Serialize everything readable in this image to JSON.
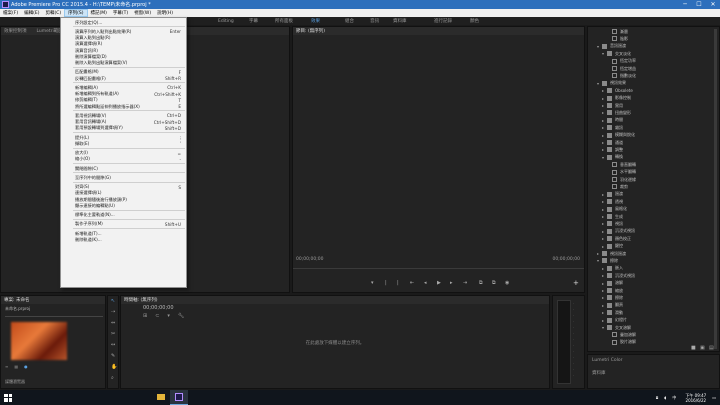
{
  "window": {
    "title": "Adobe Premiere Pro CC 2015.4 - H:\\TEMP\\未命名.prproj *",
    "minimize": "─",
    "maximize": "☐",
    "close": "✕"
  },
  "menubar": [
    {
      "label": "檔案(F)"
    },
    {
      "label": "編輯(E)"
    },
    {
      "label": "剪輯(C)"
    },
    {
      "label": "序列(S)"
    },
    {
      "label": "標記(M)"
    },
    {
      "label": "字幕(T)"
    },
    {
      "label": "視窗(W)"
    },
    {
      "label": "說明(H)"
    }
  ],
  "workspaces": [
    "Editing",
    "字幕",
    "所有面板",
    "效果",
    "組合",
    "音訊",
    "資料庫",
    "進行記錄",
    "顏色"
  ],
  "dropdown": {
    "items": [
      {
        "label": "序列設定(Q)...",
        "shortcut": "",
        "disabled": false
      },
      {
        "label": "",
        "sep": true
      },
      {
        "label": "演算序列的入點到出點效果(R)",
        "shortcut": "Enter",
        "disabled": false
      },
      {
        "label": "演算入點到出點(R)",
        "shortcut": "",
        "disabled": false
      },
      {
        "label": "演算選擇項(R)",
        "shortcut": "",
        "disabled": false
      },
      {
        "label": "演算音訊(R)",
        "shortcut": "",
        "disabled": false
      },
      {
        "label": "刪除演算檔案(D)",
        "shortcut": "",
        "disabled": false
      },
      {
        "label": "刪除入點到出點演算檔案(V)",
        "shortcut": "",
        "disabled": false
      },
      {
        "label": "",
        "sep": true
      },
      {
        "label": "匹配畫格(M)",
        "shortcut": "F",
        "disabled": false
      },
      {
        "label": "反轉匹配畫格(F)",
        "shortcut": "Shift+R",
        "disabled": false
      },
      {
        "label": "",
        "sep": true
      },
      {
        "label": "新增編輯(A)",
        "shortcut": "Ctrl+K",
        "disabled": false
      },
      {
        "label": "新增編輯到所有軌道(A)",
        "shortcut": "Ctrl+Shift+K",
        "disabled": false
      },
      {
        "label": "修剪編輯(T)",
        "shortcut": "T",
        "disabled": false
      },
      {
        "label": "將所選編輯點延伸到播放指示器(X)",
        "shortcut": "E",
        "disabled": false
      },
      {
        "label": "",
        "sep": true
      },
      {
        "label": "套用視訊轉場(V)",
        "shortcut": "Ctrl+D",
        "disabled": false
      },
      {
        "label": "套用音訊轉場(A)",
        "shortcut": "Ctrl+Shift+D",
        "disabled": false
      },
      {
        "label": "套用預設轉場到選擇項(Y)",
        "shortcut": "Shift+D",
        "disabled": false
      },
      {
        "label": "",
        "sep": true
      },
      {
        "label": "提升(L)",
        "shortcut": ";",
        "disabled": false
      },
      {
        "label": "擷取(E)",
        "shortcut": "'",
        "disabled": false
      },
      {
        "label": "",
        "sep": true
      },
      {
        "label": "放大(I)",
        "shortcut": "=",
        "disabled": false
      },
      {
        "label": "縮小(O)",
        "shortcut": "-",
        "disabled": false
      },
      {
        "label": "",
        "sep": true
      },
      {
        "label": "關閉間隙(C)",
        "shortcut": "",
        "disabled": false
      },
      {
        "label": "",
        "sep": true
      },
      {
        "label": "至序列中的間隙(G)",
        "shortcut": "",
        "disabled": false
      },
      {
        "label": "",
        "sep": true
      },
      {
        "label": "對齊(S)",
        "shortcut": "S",
        "disabled": false
      },
      {
        "label": "連接選擇項(L)",
        "shortcut": "",
        "disabled": false
      },
      {
        "label": "播放期間隨後進行播放頭(P)",
        "shortcut": "",
        "disabled": false
      },
      {
        "label": "顯示連接的編輯點(U)",
        "shortcut": "",
        "disabled": false
      },
      {
        "label": "",
        "sep": true
      },
      {
        "label": "標準化主要軌道(N)...",
        "shortcut": "",
        "disabled": false
      },
      {
        "label": "",
        "sep": true
      },
      {
        "label": "製作子序列(M)",
        "shortcut": "Shift+U",
        "disabled": false
      },
      {
        "label": "",
        "sep": true
      },
      {
        "label": "新增軌道(T)...",
        "shortcut": "",
        "disabled": false
      },
      {
        "label": "刪除軌道(K)...",
        "shortcut": "",
        "disabled": false
      }
    ]
  },
  "source_panel": {
    "tabs": [
      "效果控制項",
      "Lumetri範圍"
    ]
  },
  "program_monitor": {
    "tab": "節目: (無序列)",
    "timecode_left": "00;00;00;00",
    "timecode_right": "00;00;00;00"
  },
  "project_panel": {
    "tabs": [
      "專案: 未命名",
      "媒體瀏覽器"
    ],
    "file": "未命名.prproj",
    "status": "媒體瀏覽器"
  },
  "timeline_panel": {
    "tab": "時間軸: (無序列)",
    "timecode": "00;00;00;00",
    "placeholder": "在此處放下媒體以建立序列。"
  },
  "effects_tree": [
    {
      "label": "漸層",
      "depth": 3,
      "icon": "file"
    },
    {
      "label": "陰影",
      "depth": 3,
      "icon": "file"
    },
    {
      "label": "音訊過渡",
      "depth": 1,
      "icon": "folder",
      "open": true
    },
    {
      "label": "交叉淡化",
      "depth": 2,
      "icon": "folder",
      "open": true
    },
    {
      "label": "恆定功率",
      "depth": 3,
      "icon": "file"
    },
    {
      "label": "恆定增益",
      "depth": 3,
      "icon": "file"
    },
    {
      "label": "指數淡化",
      "depth": 3,
      "icon": "file"
    },
    {
      "label": "視訊效果",
      "depth": 1,
      "icon": "folder",
      "open": true
    },
    {
      "label": "Obsolete",
      "depth": 2,
      "icon": "folder"
    },
    {
      "label": "影像控制",
      "depth": 2,
      "icon": "folder"
    },
    {
      "label": "實用",
      "depth": 2,
      "icon": "folder"
    },
    {
      "label": "扭曲變形",
      "depth": 2,
      "icon": "folder"
    },
    {
      "label": "時間",
      "depth": 2,
      "icon": "folder"
    },
    {
      "label": "雜訊",
      "depth": 2,
      "icon": "folder"
    },
    {
      "label": "模糊與銳化",
      "depth": 2,
      "icon": "folder"
    },
    {
      "label": "通道",
      "depth": 2,
      "icon": "folder"
    },
    {
      "label": "調整",
      "depth": 2,
      "icon": "folder"
    },
    {
      "label": "轉換",
      "depth": 2,
      "icon": "folder",
      "open": true
    },
    {
      "label": "垂直翻轉",
      "depth": 3,
      "icon": "file"
    },
    {
      "label": "水平翻轉",
      "depth": 3,
      "icon": "file"
    },
    {
      "label": "羽化邊緣",
      "depth": 3,
      "icon": "file"
    },
    {
      "label": "裁剪",
      "depth": 3,
      "icon": "file"
    },
    {
      "label": "過渡",
      "depth": 2,
      "icon": "folder"
    },
    {
      "label": "透視",
      "depth": 2,
      "icon": "folder"
    },
    {
      "label": "風格化",
      "depth": 2,
      "icon": "folder"
    },
    {
      "label": "生成",
      "depth": 2,
      "icon": "folder"
    },
    {
      "label": "視訊",
      "depth": 2,
      "icon": "folder"
    },
    {
      "label": "沉浸式視訊",
      "depth": 2,
      "icon": "folder"
    },
    {
      "label": "顏色校正",
      "depth": 2,
      "icon": "folder"
    },
    {
      "label": "鍵控",
      "depth": 2,
      "icon": "folder"
    },
    {
      "label": "視訊過渡",
      "depth": 1,
      "icon": "folder"
    },
    {
      "label": "擦除",
      "depth": 1,
      "icon": "folder",
      "open": true
    },
    {
      "label": "嵌入",
      "depth": 2,
      "icon": "folder"
    },
    {
      "label": "沉浸式視訊",
      "depth": 2,
      "icon": "folder"
    },
    {
      "label": "溶解",
      "depth": 2,
      "icon": "folder"
    },
    {
      "label": "縮放",
      "depth": 2,
      "icon": "folder"
    },
    {
      "label": "擦除",
      "depth": 2,
      "icon": "folder"
    },
    {
      "label": "翻頁",
      "depth": 2,
      "icon": "folder"
    },
    {
      "label": "滑動",
      "depth": 2,
      "icon": "folder"
    },
    {
      "label": "幻燈片",
      "depth": 2,
      "icon": "folder"
    },
    {
      "label": "交叉溶解",
      "depth": 2,
      "icon": "folder",
      "open": true
    },
    {
      "label": "疊加溶解",
      "depth": 3,
      "icon": "file"
    },
    {
      "label": "胶片溶解",
      "depth": 3,
      "icon": "file"
    }
  ],
  "lumetri": {
    "title": "Lumetri Color",
    "sub": "資料庫"
  },
  "taskbar": {
    "ime": "中",
    "time": "下午 09:47",
    "date": "2016/6/22"
  },
  "colors": {
    "accent": "#2d6fbc",
    "workspace_active": "#5aa0e0"
  },
  "icons": [
    "windows-logo-icon",
    "folder-icon",
    "wrench-icon",
    "play-icon",
    "step-back-icon",
    "step-forward-icon",
    "mark-in-icon",
    "mark-out-icon",
    "add-icon",
    "arrow-tool-icon",
    "pen-tool-icon",
    "hand-tool-icon",
    "zoom-tool-icon"
  ]
}
